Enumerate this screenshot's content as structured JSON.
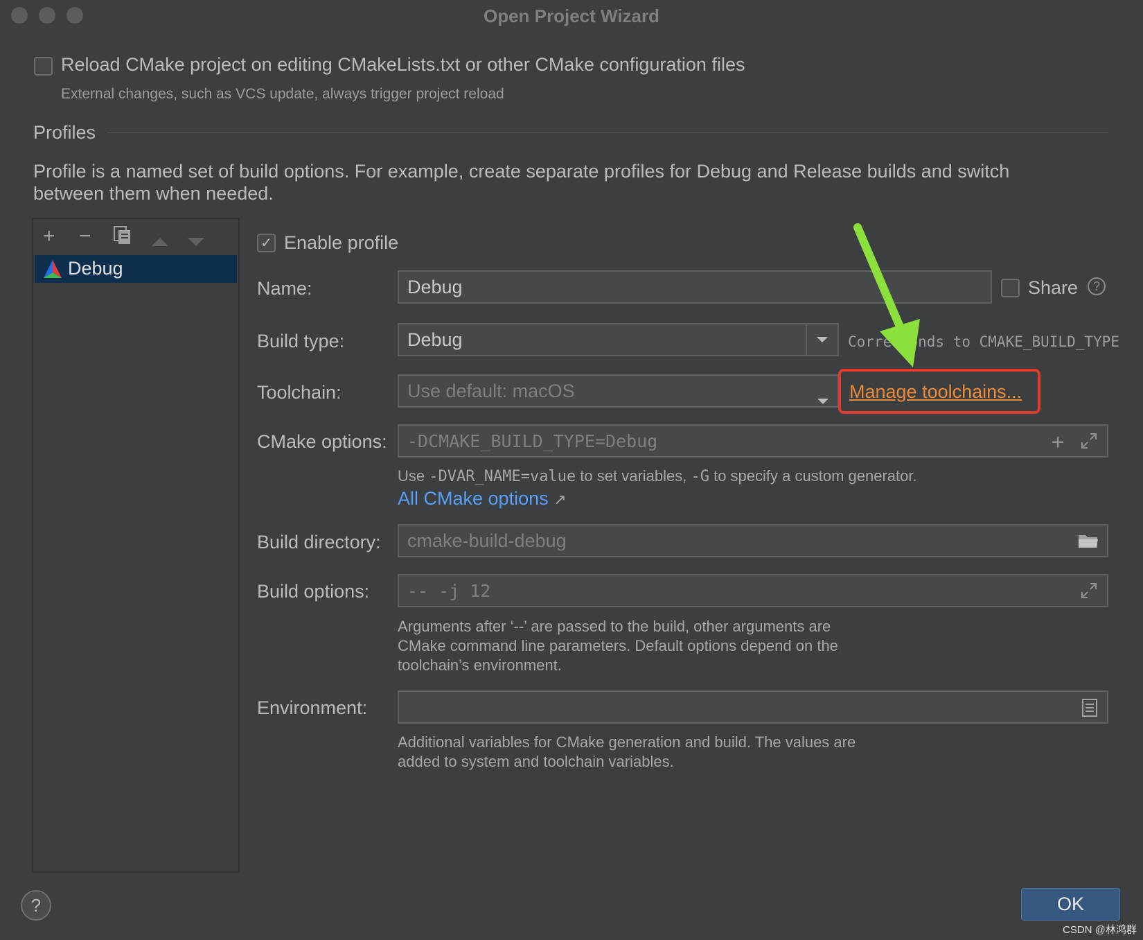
{
  "window": {
    "title": "Open Project Wizard"
  },
  "reload": {
    "label": "Reload CMake project on editing CMakeLists.txt or other CMake configuration files",
    "hint": "External changes, such as VCS update, always trigger project reload",
    "checked": false
  },
  "profiles": {
    "section_title": "Profiles",
    "description_line1": "Profile is a named set of build options. For example, create separate profiles for Debug and Release builds and switch",
    "description_line2": "between them when needed.",
    "toolbar": [
      "add-icon",
      "remove-icon",
      "copy-icon",
      "move-up-icon",
      "move-down-icon"
    ],
    "items": [
      {
        "label": "Debug",
        "selected": true
      }
    ]
  },
  "form": {
    "enable_profile_label": "Enable profile",
    "enable_profile_checked": true,
    "name_label": "Name:",
    "name_value": "Debug",
    "share_label": "Share",
    "build_type_label": "Build type:",
    "build_type_value": "Debug",
    "build_type_hint": "Corresponds to CMAKE_BUILD_TYPE",
    "toolchain_label": "Toolchain:",
    "toolchain_value": "Use default: macOS",
    "manage_toolchains": "Manage toolchains...",
    "cmake_options_label": "CMake options:",
    "cmake_options_placeholder": "-DCMAKE_BUILD_TYPE=Debug",
    "cmake_hint_prefix": "Use ",
    "cmake_hint_var": "-DVAR_NAME=value",
    "cmake_hint_middle": " to set variables, ",
    "cmake_hint_g": "-G",
    "cmake_hint_suffix": " to specify a custom generator.",
    "all_cmake_options": "All CMake options",
    "all_cmake_options_arrow": "↗",
    "build_dir_label": "Build directory:",
    "build_dir_placeholder": "cmake-build-debug",
    "build_options_label": "Build options:",
    "build_options_placeholder": "-- -j 12",
    "build_options_hint_1": "Arguments after ‘--’ are passed to the build, other arguments are",
    "build_options_hint_2": "CMake command line parameters. Default options depend on the",
    "build_options_hint_3": "toolchain’s environment.",
    "environment_label": "Environment:",
    "environment_value": "",
    "environment_hint_1": "Additional variables for CMake generation and build. The values are",
    "environment_hint_2": "added to system and toolchain variables."
  },
  "footer": {
    "help": "?",
    "ok": "OK",
    "watermark": "CSDN @林鸿群"
  },
  "colors": {
    "background": "#3c3f41",
    "selection": "#0d2e4c",
    "link": "#589df6",
    "manage_link": "#ec8a35",
    "annotation_box": "#e03a2a",
    "annotation_arrow": "#8be03b",
    "ok_button": "#365880"
  }
}
